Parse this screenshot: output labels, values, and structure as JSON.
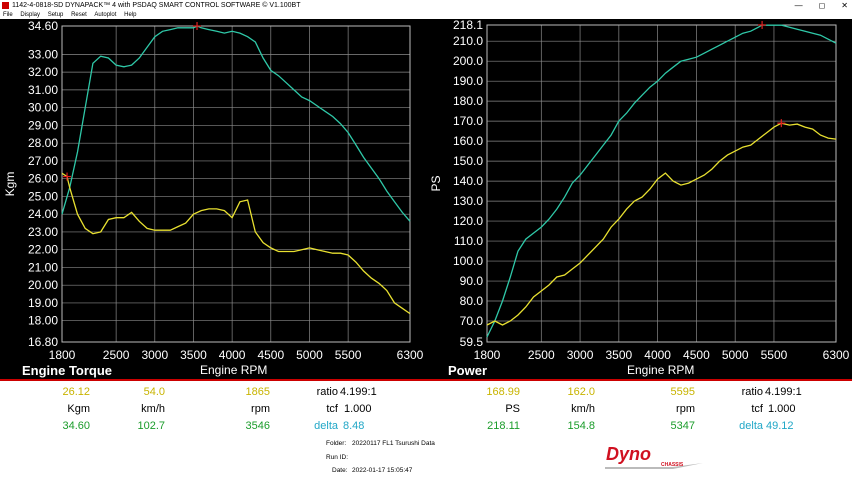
{
  "window": {
    "title": "1142-4-0818-SD DYNAPACK™ 4 with PSDAQ SMART CONTROL SOFTWARE © V1.100BT",
    "controls": [
      "—",
      "◻",
      "✕"
    ]
  },
  "menu": [
    "File",
    "Display",
    "Setup",
    "Reset",
    "Autoplot",
    "Help"
  ],
  "swatch_colors": [
    "#e60000",
    "#ffe000",
    "#00c800",
    "#00a0ff",
    "#ff40ff",
    "#20e0e0",
    "#a0a0a0"
  ],
  "torque_chart": {
    "section_title": "Engine Torque",
    "xlabel": "Engine RPM",
    "ylabel": "Kgm",
    "yticks": [
      "34.60",
      "33.00",
      "32.00",
      "31.00",
      "30.00",
      "29.00",
      "28.00",
      "27.00",
      "26.00",
      "25.00",
      "24.00",
      "23.00",
      "22.00",
      "21.00",
      "20.00",
      "19.00",
      "18.00",
      "16.80"
    ]
  },
  "power_chart": {
    "section_title": "Power",
    "xlabel": "Engine RPM",
    "ylabel": "PS",
    "yticks": [
      "218.1",
      "210.0",
      "200.0",
      "190.0",
      "180.0",
      "170.0",
      "160.0",
      "150.0",
      "140.0",
      "130.0",
      "120.0",
      "110.0",
      "100.0",
      "90.0",
      "80.0",
      "70.0",
      "59.5"
    ]
  },
  "xticks": [
    "1800",
    "2500",
    "3000",
    "3500",
    "4000",
    "4500",
    "5000",
    "5500",
    "6300"
  ],
  "chart_data": [
    {
      "type": "line",
      "title": "Engine Torque",
      "xlabel": "Engine RPM",
      "ylabel": "Kgm",
      "xlim": [
        1800,
        6300
      ],
      "ylim": [
        16.8,
        34.6
      ],
      "grid": true,
      "series": [
        {
          "color": "#2fc8a8",
          "x": [
            1800,
            1900,
            2000,
            2100,
            2200,
            2300,
            2400,
            2500,
            2600,
            2700,
            2800,
            2900,
            3000,
            3100,
            3200,
            3300,
            3400,
            3500,
            3550,
            3600,
            3700,
            3800,
            3900,
            4000,
            4100,
            4200,
            4300,
            4400,
            4500,
            4600,
            4700,
            4800,
            4900,
            5000,
            5100,
            5200,
            5300,
            5400,
            5500,
            5600,
            5700,
            5800,
            5900,
            6000,
            6100,
            6200,
            6300
          ],
          "values": [
            24.0,
            25.5,
            27.5,
            30.0,
            32.5,
            32.9,
            32.8,
            32.4,
            32.3,
            32.4,
            32.8,
            33.4,
            34.0,
            34.3,
            34.4,
            34.5,
            34.5,
            34.5,
            34.6,
            34.5,
            34.4,
            34.3,
            34.2,
            34.3,
            34.2,
            34.0,
            33.7,
            32.8,
            32.1,
            31.8,
            31.4,
            31.0,
            30.6,
            30.4,
            30.1,
            29.8,
            29.5,
            29.1,
            28.6,
            27.9,
            27.2,
            26.6,
            26.0,
            25.3,
            24.7,
            24.1,
            23.6
          ]
        },
        {
          "color": "#e8e030",
          "x": [
            1800,
            1865,
            1900,
            2000,
            2100,
            2200,
            2300,
            2400,
            2500,
            2600,
            2700,
            2800,
            2900,
            3000,
            3100,
            3200,
            3300,
            3400,
            3500,
            3600,
            3700,
            3800,
            3900,
            4000,
            4100,
            4200,
            4300,
            4400,
            4500,
            4600,
            4700,
            4800,
            4900,
            5000,
            5100,
            5200,
            5300,
            5400,
            5500,
            5600,
            5700,
            5800,
            5900,
            6000,
            6100,
            6200,
            6300
          ],
          "values": [
            26.3,
            26.12,
            25.5,
            24.0,
            23.2,
            22.9,
            23.0,
            23.7,
            23.8,
            23.8,
            24.1,
            23.6,
            23.2,
            23.1,
            23.1,
            23.1,
            23.3,
            23.5,
            24.0,
            24.2,
            24.3,
            24.3,
            24.2,
            23.8,
            24.7,
            24.8,
            23.0,
            22.4,
            22.1,
            21.9,
            21.9,
            21.9,
            22.0,
            22.1,
            22.0,
            21.9,
            21.8,
            21.8,
            21.7,
            21.3,
            20.8,
            20.4,
            20.1,
            19.7,
            19.0,
            18.7,
            18.4
          ]
        }
      ],
      "markers": [
        {
          "x": 1865,
          "y": 26.12
        },
        {
          "x": 3546,
          "y": 34.6
        }
      ]
    },
    {
      "type": "line",
      "title": "Power",
      "xlabel": "Engine RPM",
      "ylabel": "PS",
      "xlim": [
        1800,
        6300
      ],
      "ylim": [
        59.5,
        218.1
      ],
      "grid": true,
      "series": [
        {
          "color": "#2fc8a8",
          "x": [
            1800,
            1900,
            2000,
            2100,
            2200,
            2300,
            2400,
            2500,
            2600,
            2700,
            2800,
            2900,
            3000,
            3100,
            3200,
            3300,
            3400,
            3500,
            3600,
            3700,
            3800,
            3900,
            4000,
            4100,
            4200,
            4300,
            4400,
            4500,
            4600,
            4700,
            4800,
            4900,
            5000,
            5100,
            5200,
            5300,
            5347,
            5400,
            5500,
            5600,
            5700,
            5800,
            5900,
            6000,
            6100,
            6200,
            6300
          ],
          "values": [
            62.0,
            70.0,
            80.0,
            92.0,
            105.0,
            111.0,
            114.0,
            117.0,
            121.0,
            126.0,
            132.0,
            139.0,
            143.0,
            148.0,
            153.0,
            158.0,
            163.0,
            170.0,
            174.0,
            179.0,
            183.0,
            187.0,
            190.0,
            194.0,
            197.0,
            200.0,
            201.0,
            202.0,
            204.0,
            206.0,
            208.0,
            210.0,
            212.0,
            214.0,
            215.0,
            217.0,
            218.11,
            218.0,
            218.0,
            218.0,
            217.0,
            216.0,
            215.0,
            214.0,
            213.0,
            211.0,
            209.0
          ]
        },
        {
          "color": "#e8e030",
          "x": [
            1800,
            1900,
            2000,
            2100,
            2200,
            2300,
            2400,
            2500,
            2600,
            2700,
            2800,
            2900,
            3000,
            3100,
            3200,
            3300,
            3400,
            3500,
            3600,
            3700,
            3800,
            3900,
            4000,
            4100,
            4200,
            4300,
            4400,
            4500,
            4600,
            4700,
            4800,
            4900,
            5000,
            5100,
            5200,
            5300,
            5400,
            5500,
            5595,
            5700,
            5800,
            5900,
            6000,
            6100,
            6200,
            6300
          ],
          "values": [
            68.0,
            70.0,
            68.0,
            70.0,
            73.0,
            77.0,
            82.0,
            85.0,
            88.0,
            92.0,
            93.0,
            96.0,
            99.0,
            103.0,
            107.0,
            111.0,
            117.0,
            121.0,
            126.0,
            130.0,
            132.0,
            136.0,
            141.0,
            144.0,
            140.0,
            138.0,
            139.0,
            141.0,
            143.0,
            146.0,
            150.0,
            153.0,
            155.0,
            157.0,
            158.0,
            161.0,
            164.0,
            167.0,
            168.99,
            168.0,
            168.5,
            167.0,
            166.0,
            163.0,
            161.5,
            161.0
          ]
        }
      ],
      "markers": [
        {
          "x": 5347,
          "y": 218.11
        },
        {
          "x": 5595,
          "y": 168.99
        }
      ]
    }
  ],
  "torque_readout": {
    "row1": {
      "a": "26.12",
      "b": "54.0",
      "c": "1865",
      "ratio_label": "ratio",
      "ratio_value": "4.199:1"
    },
    "row2": {
      "a": "Kgm",
      "b": "km/h",
      "c": "rpm",
      "tcf_label": "tcf",
      "tcf_value": "1.000"
    },
    "row3": {
      "a": "34.60",
      "b": "102.7",
      "c": "3546",
      "delta_label": "delta",
      "delta_value": "8.48"
    }
  },
  "power_readout": {
    "row1": {
      "a": "168.99",
      "b": "162.0",
      "c": "5595",
      "ratio_label": "ratio",
      "ratio_value": "4.199:1"
    },
    "row2": {
      "a": "PS",
      "b": "km/h",
      "c": "rpm",
      "tcf_label": "tcf",
      "tcf_value": "1.000"
    },
    "row3": {
      "a": "218.11",
      "b": "154.8",
      "c": "5347",
      "delta_label": "delta",
      "delta_value": "49.12"
    }
  },
  "meta": {
    "folder_label": "Folder:",
    "folder_value": "20220117 FL1 Tsurushi Data",
    "runid_label": "Run ID:",
    "runid_value": "",
    "date_label": "Date:",
    "date_value": "2022-01-17 15:05:47"
  },
  "logo": {
    "text": "Dyno",
    "subtext": "CHASSIS"
  },
  "colors": {
    "accent_red": "#cc0000",
    "grid": "#8a8a8a",
    "torque_line": "#2fc8a8",
    "power_line": "#e8e030"
  }
}
